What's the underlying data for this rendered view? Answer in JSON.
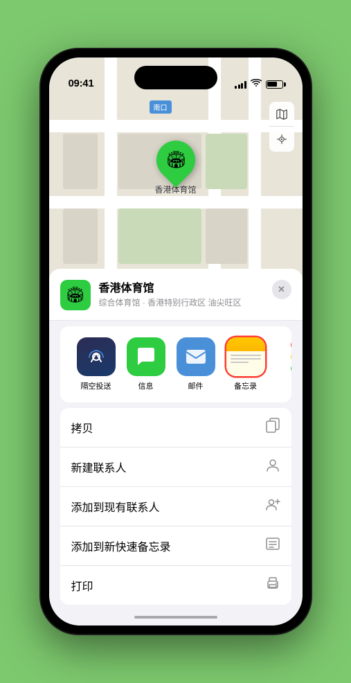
{
  "status_bar": {
    "time": "09:41",
    "location_icon": "▶"
  },
  "map": {
    "label": "南口",
    "venue_pin_label": "香港体育馆",
    "controls": {
      "map_icon": "🗺",
      "location_icon": "⬆"
    }
  },
  "venue_card": {
    "name": "香港体育馆",
    "subtitle": "综合体育馆 · 香港特别行政区 油尖旺区",
    "close_label": "✕"
  },
  "share_apps": [
    {
      "id": "airdrop",
      "label": "隔空投送",
      "icon_type": "airdrop"
    },
    {
      "id": "messages",
      "label": "信息",
      "icon_type": "messages"
    },
    {
      "id": "mail",
      "label": "邮件",
      "icon_type": "mail"
    },
    {
      "id": "notes",
      "label": "备忘录",
      "icon_type": "notes",
      "selected": true
    }
  ],
  "actions": [
    {
      "id": "copy",
      "label": "拷贝",
      "icon": "⎘"
    },
    {
      "id": "new-contact",
      "label": "新建联系人",
      "icon": "👤"
    },
    {
      "id": "add-existing",
      "label": "添加到现有联系人",
      "icon": "👤"
    },
    {
      "id": "add-note",
      "label": "添加到新快速备忘录",
      "icon": "📋"
    },
    {
      "id": "print",
      "label": "打印",
      "icon": "🖨"
    }
  ],
  "colors": {
    "green_accent": "#2ecc40",
    "selected_border": "#ff3b30",
    "blue_accent": "#4a90d9"
  }
}
